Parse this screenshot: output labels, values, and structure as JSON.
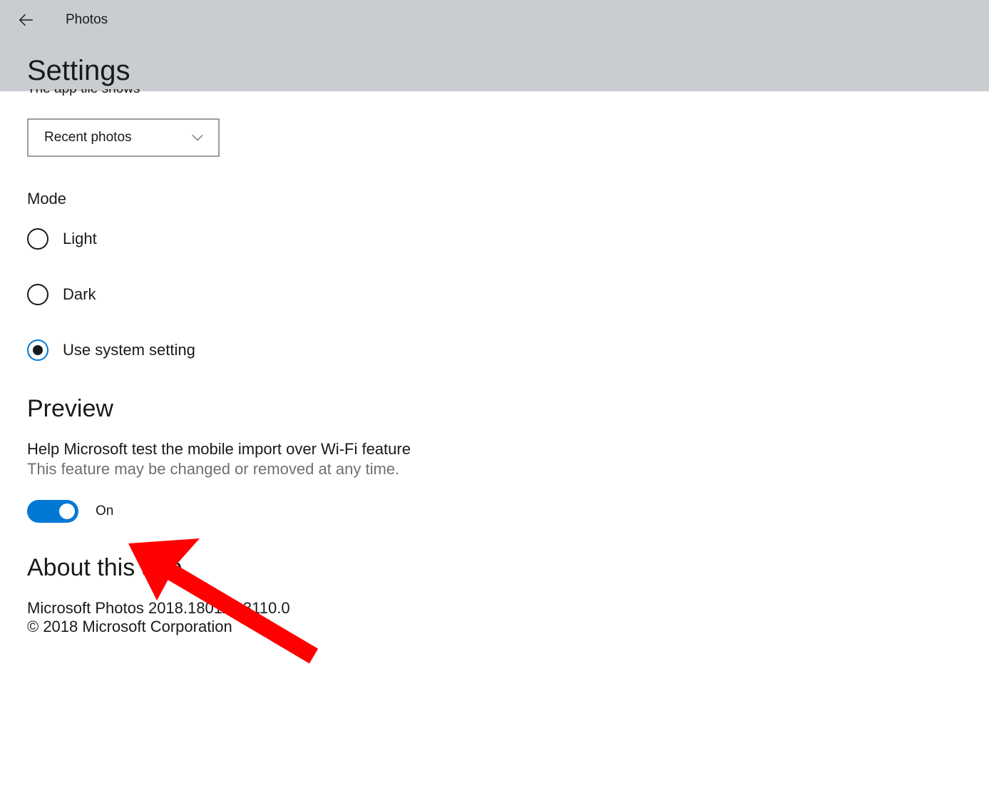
{
  "header": {
    "app_name": "Photos",
    "page_title": "Settings"
  },
  "tile": {
    "clipped_label": "The app tile shows",
    "dropdown_value": "Recent photos"
  },
  "mode": {
    "label": "Mode",
    "options": {
      "light": "Light",
      "dark": "Dark",
      "system": "Use system setting"
    },
    "selected": "system"
  },
  "preview": {
    "heading": "Preview",
    "desc1": "Help Microsoft test the mobile import over Wi-Fi feature",
    "desc2": "This feature may be changed or removed at any time.",
    "toggle_state": "On"
  },
  "about": {
    "heading": "About this app",
    "version": "Microsoft Photos 2018.18011.13110.0",
    "copyright": "© 2018 Microsoft Corporation"
  }
}
